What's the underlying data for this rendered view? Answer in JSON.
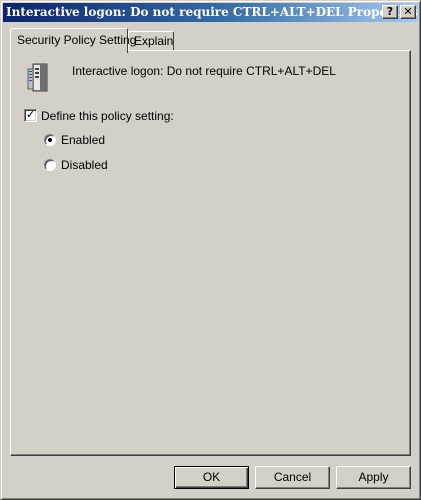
{
  "window": {
    "title": "Interactive logon: Do not require CTRL+ALT+DEL Properties",
    "help_label": "?",
    "close_label": "✕"
  },
  "tabs": [
    {
      "label": "Security Policy Setting",
      "active": true
    },
    {
      "label": "Explain",
      "active": false
    }
  ],
  "policy": {
    "name": "Interactive logon: Do not require CTRL+ALT+DEL",
    "icon": "policy-server-icon"
  },
  "define": {
    "label": "Define this policy setting:",
    "checked": true,
    "check_glyph": "✓"
  },
  "options": {
    "enabled": {
      "label": "Enabled",
      "selected": true
    },
    "disabled": {
      "label": "Disabled",
      "selected": false
    }
  },
  "buttons": {
    "ok": "OK",
    "cancel": "Cancel",
    "apply": "Apply"
  },
  "colors": {
    "face": "#d4d0c8",
    "title_start": "#0a246a",
    "title_end": "#a6caf0"
  }
}
